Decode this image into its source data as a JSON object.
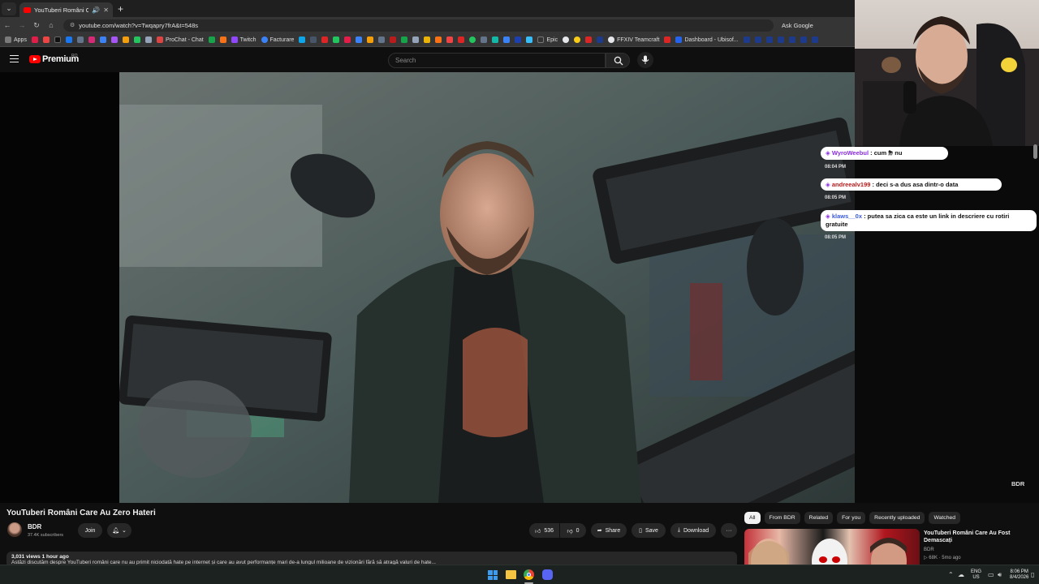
{
  "browser": {
    "tab_title": "YouTuberi Români Care Au",
    "url": "youtube.com/watch?v=Twqapry7frA&t=548s",
    "ask_google": "Ask Google",
    "bookmarks": [
      {
        "label": "Apps",
        "color": "#7a7a7a"
      },
      {
        "label": "ProChat - Chat",
        "color": "#d44"
      },
      {
        "label": "Twitch",
        "color": "#9146ff"
      },
      {
        "label": "Facturare",
        "color": "#3b82f6"
      },
      {
        "label": "Epic",
        "color": "#333333"
      },
      {
        "label": "FFXIV Teamcraft",
        "color": "#555555"
      },
      {
        "label": "Dashboard - Ubisof...",
        "color": "#2563eb"
      }
    ]
  },
  "yt": {
    "premium_label": "Premium",
    "premium_sup": "RO",
    "search_placeholder": "Search"
  },
  "video": {
    "watermark": "BDR",
    "title": "YouTuberi Români Care Au Zero Hateri",
    "channel": "BDR",
    "subscribers": "37.4K subscribers",
    "join": "Join",
    "likes": "536",
    "dislikes": "0",
    "share": "Share",
    "save": "Save",
    "download": "Download",
    "more": "···",
    "views": "3,031 views  1 hour ago",
    "description": "Astăzi discutăm despre YouTuberi români care nu au primit niciodată hate pe internet și care au avut performanțe mari de-a lungul milioane de vizionări fără să atragă valuri de hate..."
  },
  "chips": [
    "All",
    "From BDR",
    "Related",
    "For you",
    "Recently uploaded",
    "Watched"
  ],
  "recommended": {
    "title": "YouTuberi Români Care Au Fost Demascați",
    "channel": "BDR",
    "meta": "68K · 5mo ago"
  },
  "chat": [
    {
      "user": "WyroWeebul",
      "text": " : cum ⛈ nu",
      "time": "08:04 PM"
    },
    {
      "user": "andreealv199",
      "text": " : deci s-a dus asa dintr-o data",
      "time": "08:05 PM"
    },
    {
      "user": "klaws__0x",
      "text": " : putea sa zica ca este un link in descriere cu rotiri gratuite",
      "time": "08:05 PM"
    }
  ],
  "taskbar": {
    "lang": "ENG",
    "region": "US",
    "time": "8:06 PM",
    "date": "8/4/2026"
  }
}
